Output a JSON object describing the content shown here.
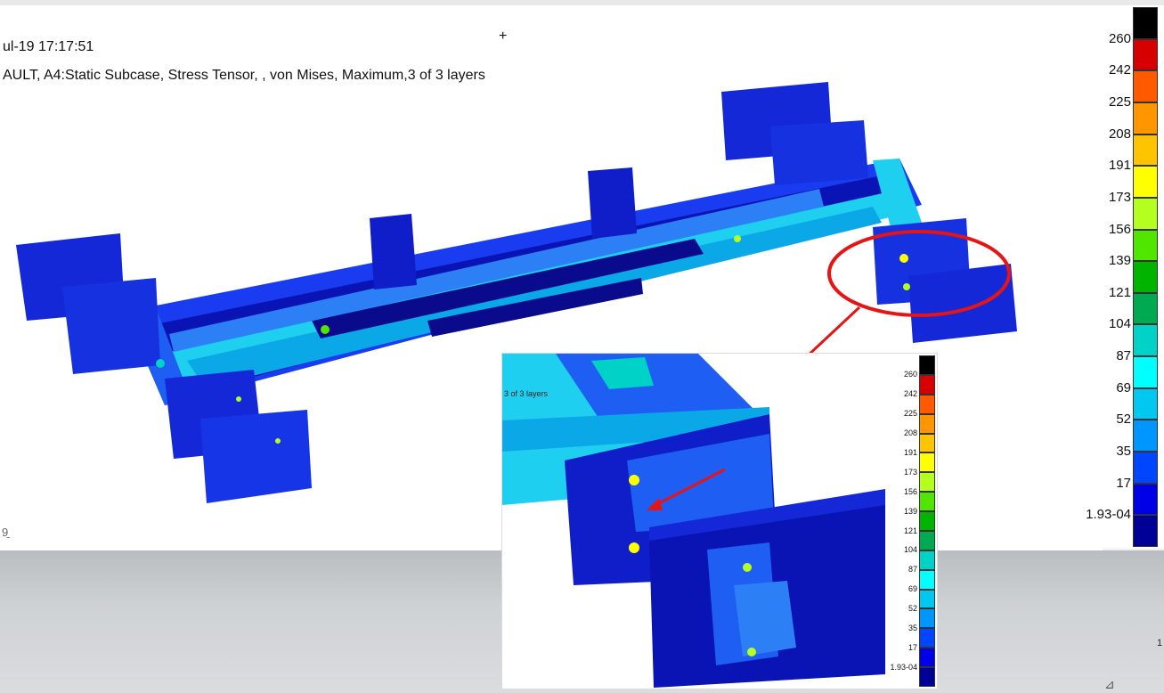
{
  "header": {
    "timestamp": "ul-19 17:17:51",
    "subtitle": "AULT, A4:Static Subcase, Stress Tensor, , von Mises, Maximum,3 of 3 layers"
  },
  "cursor_glyph": "+",
  "triad_label": "9̱",
  "legend": {
    "colors": [
      "#000000",
      "#d60000",
      "#ff5a00",
      "#ff9600",
      "#ffc400",
      "#ffff00",
      "#b4ff1e",
      "#50e600",
      "#00b400",
      "#00aa50",
      "#00d2c8",
      "#00ffff",
      "#00c8f0",
      "#0096ff",
      "#0046ff",
      "#0000e6",
      "#000096"
    ],
    "labels": [
      "260",
      "242",
      "225",
      "208",
      "191",
      "173",
      "156",
      "139",
      "121",
      "104",
      "87",
      "69",
      "52",
      "35",
      "17",
      "1.93-04"
    ]
  },
  "inset": {
    "caption": "3 of 3 layers"
  },
  "corner_labels": [
    "1",
    "⊿"
  ]
}
